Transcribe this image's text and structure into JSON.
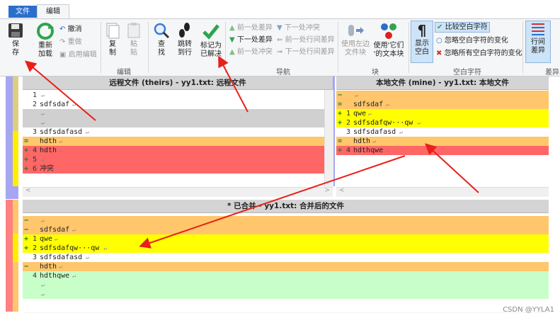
{
  "tabs": {
    "file": "文件",
    "edit": "编辑"
  },
  "ribbon": {
    "save": "保\n存",
    "reload": "重新\n加载",
    "undo": "撤消",
    "redo": "重做",
    "enable_edit": "启用编辑",
    "copy": "复\n制",
    "paste": "粘\n贴",
    "find": "查\n找",
    "goto": "跳转\n到行",
    "mark_resolved": "标记为\n已解决",
    "prev_diff": "前一处差异",
    "next_diff": "下一处差异",
    "prev_conflict": "前一处冲突",
    "next_conflict": "下一处冲突",
    "prev_line_diff": "前一处行间差异",
    "next_line_diff": "下一处行间差异",
    "use_left_block": "使用左边\n文件块",
    "use_their_text": "使用'它们\n'的文本块",
    "show_whitespace": "显示\n空白",
    "compare_ws": "比较空白字符",
    "ignore_ws_change": "忽略空白字符的变化",
    "ignore_all_ws_change": "忽略所有空白字符的变化",
    "line_diff": "行间\n差异",
    "grp_edit": "编辑",
    "grp_nav": "导航",
    "grp_block": "块",
    "grp_ws": "空白字符",
    "grp_diff": "差异"
  },
  "theirs": {
    "title": "远程文件 (theirs) - yy1.txt: 远程文件",
    "lines": [
      {
        "mark": "",
        "num": "1",
        "text": "",
        "bg": "#ffffff"
      },
      {
        "mark": "",
        "num": "2",
        "text": "sdfsdaf",
        "bg": "#ffffff"
      },
      {
        "mark": "",
        "num": "",
        "text": "",
        "bg": "#d0d0d0"
      },
      {
        "mark": "",
        "num": "",
        "text": "",
        "bg": "#d0d0d0"
      },
      {
        "mark": "",
        "num": "3",
        "text": "sdfsdafasd",
        "bg": "#ffffff"
      },
      {
        "mark": "=",
        "num": "",
        "text": "hdth",
        "bg": "#ffc66b"
      },
      {
        "mark": "+",
        "num": "4",
        "text": "hdth",
        "bg": "#ff6666"
      },
      {
        "mark": "+",
        "num": "5",
        "text": "",
        "bg": "#ff6666"
      },
      {
        "mark": "+",
        "num": "6",
        "text": "冲突",
        "bg": "#ff6666"
      }
    ]
  },
  "mine": {
    "title": "本地文件 (mine) - yy1.txt: 本地文件",
    "lines": [
      {
        "mark": "−",
        "num": "",
        "text": "",
        "bg": "#ffc66b"
      },
      {
        "mark": "=",
        "num": "",
        "text": "sdfsdaf",
        "bg": "#ffc66b"
      },
      {
        "mark": "+",
        "num": "1",
        "text": "qwe",
        "bg": "#ffff00"
      },
      {
        "mark": "+",
        "num": "2",
        "text": "sdfsdafqw···qw",
        "bg": "#ffff00"
      },
      {
        "mark": "",
        "num": "3",
        "text": "sdfsdafasd",
        "bg": "#ffffff"
      },
      {
        "mark": "=",
        "num": "",
        "text": "hdth",
        "bg": "#ffc66b"
      },
      {
        "mark": "+",
        "num": "4",
        "text": "hdthqwe",
        "bg": "#ff6666"
      }
    ]
  },
  "merged": {
    "title": "* 已合并 - yy1.txt: 合并后的文件",
    "lines": [
      {
        "mark": "−",
        "num": "",
        "text": "",
        "bg": "#ffc66b"
      },
      {
        "mark": "−",
        "num": "",
        "text": "sdfsdaf",
        "bg": "#ffc66b"
      },
      {
        "mark": "+",
        "num": "1",
        "text": "qwe",
        "bg": "#ffff00"
      },
      {
        "mark": "+",
        "num": "2",
        "text": "sdfsdafqw···qw",
        "bg": "#ffff00"
      },
      {
        "mark": "",
        "num": "3",
        "text": "sdfsdafasd",
        "bg": "#ffffff"
      },
      {
        "mark": "−",
        "num": "",
        "text": "hdth",
        "bg": "#ffc66b"
      },
      {
        "mark": "",
        "num": "4",
        "text": "hdthqwe",
        "bg": "#c8ffc8"
      },
      {
        "mark": "",
        "num": "",
        "text": "",
        "bg": "#c8ffc8"
      },
      {
        "mark": "",
        "num": "",
        "text": "",
        "bg": "#c8ffc8"
      }
    ]
  },
  "watermark": "CSDN @YYLA1",
  "colors": {
    "conflict": "#ff6666",
    "changed": "#ffc66b",
    "added": "#ffff00",
    "merged_new": "#c8ffc8",
    "accent": "#2b6fcd"
  }
}
